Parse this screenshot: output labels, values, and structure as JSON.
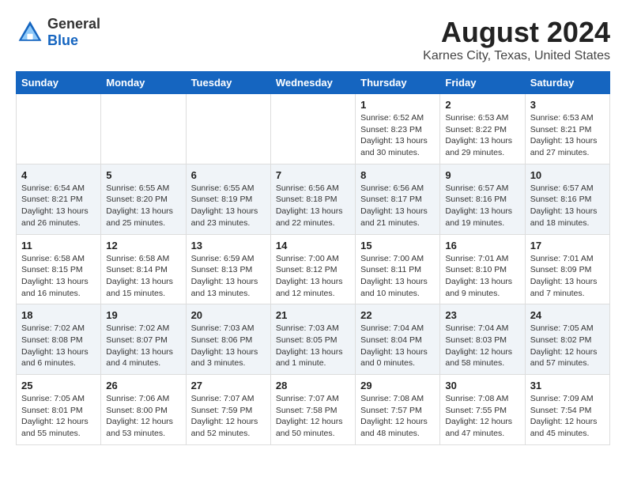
{
  "header": {
    "logo_general": "General",
    "logo_blue": "Blue",
    "month_title": "August 2024",
    "location": "Karnes City, Texas, United States"
  },
  "weekdays": [
    "Sunday",
    "Monday",
    "Tuesday",
    "Wednesday",
    "Thursday",
    "Friday",
    "Saturday"
  ],
  "weeks": [
    [
      {
        "day": "",
        "sunrise": "",
        "sunset": "",
        "daylight": ""
      },
      {
        "day": "",
        "sunrise": "",
        "sunset": "",
        "daylight": ""
      },
      {
        "day": "",
        "sunrise": "",
        "sunset": "",
        "daylight": ""
      },
      {
        "day": "",
        "sunrise": "",
        "sunset": "",
        "daylight": ""
      },
      {
        "day": "1",
        "sunrise": "6:52 AM",
        "sunset": "8:23 PM",
        "daylight": "13 hours and 30 minutes."
      },
      {
        "day": "2",
        "sunrise": "6:53 AM",
        "sunset": "8:22 PM",
        "daylight": "13 hours and 29 minutes."
      },
      {
        "day": "3",
        "sunrise": "6:53 AM",
        "sunset": "8:21 PM",
        "daylight": "13 hours and 27 minutes."
      }
    ],
    [
      {
        "day": "4",
        "sunrise": "6:54 AM",
        "sunset": "8:21 PM",
        "daylight": "13 hours and 26 minutes."
      },
      {
        "day": "5",
        "sunrise": "6:55 AM",
        "sunset": "8:20 PM",
        "daylight": "13 hours and 25 minutes."
      },
      {
        "day": "6",
        "sunrise": "6:55 AM",
        "sunset": "8:19 PM",
        "daylight": "13 hours and 23 minutes."
      },
      {
        "day": "7",
        "sunrise": "6:56 AM",
        "sunset": "8:18 PM",
        "daylight": "13 hours and 22 minutes."
      },
      {
        "day": "8",
        "sunrise": "6:56 AM",
        "sunset": "8:17 PM",
        "daylight": "13 hours and 21 minutes."
      },
      {
        "day": "9",
        "sunrise": "6:57 AM",
        "sunset": "8:16 PM",
        "daylight": "13 hours and 19 minutes."
      },
      {
        "day": "10",
        "sunrise": "6:57 AM",
        "sunset": "8:16 PM",
        "daylight": "13 hours and 18 minutes."
      }
    ],
    [
      {
        "day": "11",
        "sunrise": "6:58 AM",
        "sunset": "8:15 PM",
        "daylight": "13 hours and 16 minutes."
      },
      {
        "day": "12",
        "sunrise": "6:58 AM",
        "sunset": "8:14 PM",
        "daylight": "13 hours and 15 minutes."
      },
      {
        "day": "13",
        "sunrise": "6:59 AM",
        "sunset": "8:13 PM",
        "daylight": "13 hours and 13 minutes."
      },
      {
        "day": "14",
        "sunrise": "7:00 AM",
        "sunset": "8:12 PM",
        "daylight": "13 hours and 12 minutes."
      },
      {
        "day": "15",
        "sunrise": "7:00 AM",
        "sunset": "8:11 PM",
        "daylight": "13 hours and 10 minutes."
      },
      {
        "day": "16",
        "sunrise": "7:01 AM",
        "sunset": "8:10 PM",
        "daylight": "13 hours and 9 minutes."
      },
      {
        "day": "17",
        "sunrise": "7:01 AM",
        "sunset": "8:09 PM",
        "daylight": "13 hours and 7 minutes."
      }
    ],
    [
      {
        "day": "18",
        "sunrise": "7:02 AM",
        "sunset": "8:08 PM",
        "daylight": "13 hours and 6 minutes."
      },
      {
        "day": "19",
        "sunrise": "7:02 AM",
        "sunset": "8:07 PM",
        "daylight": "13 hours and 4 minutes."
      },
      {
        "day": "20",
        "sunrise": "7:03 AM",
        "sunset": "8:06 PM",
        "daylight": "13 hours and 3 minutes."
      },
      {
        "day": "21",
        "sunrise": "7:03 AM",
        "sunset": "8:05 PM",
        "daylight": "13 hours and 1 minute."
      },
      {
        "day": "22",
        "sunrise": "7:04 AM",
        "sunset": "8:04 PM",
        "daylight": "13 hours and 0 minutes."
      },
      {
        "day": "23",
        "sunrise": "7:04 AM",
        "sunset": "8:03 PM",
        "daylight": "12 hours and 58 minutes."
      },
      {
        "day": "24",
        "sunrise": "7:05 AM",
        "sunset": "8:02 PM",
        "daylight": "12 hours and 57 minutes."
      }
    ],
    [
      {
        "day": "25",
        "sunrise": "7:05 AM",
        "sunset": "8:01 PM",
        "daylight": "12 hours and 55 minutes."
      },
      {
        "day": "26",
        "sunrise": "7:06 AM",
        "sunset": "8:00 PM",
        "daylight": "12 hours and 53 minutes."
      },
      {
        "day": "27",
        "sunrise": "7:07 AM",
        "sunset": "7:59 PM",
        "daylight": "12 hours and 52 minutes."
      },
      {
        "day": "28",
        "sunrise": "7:07 AM",
        "sunset": "7:58 PM",
        "daylight": "12 hours and 50 minutes."
      },
      {
        "day": "29",
        "sunrise": "7:08 AM",
        "sunset": "7:57 PM",
        "daylight": "12 hours and 48 minutes."
      },
      {
        "day": "30",
        "sunrise": "7:08 AM",
        "sunset": "7:55 PM",
        "daylight": "12 hours and 47 minutes."
      },
      {
        "day": "31",
        "sunrise": "7:09 AM",
        "sunset": "7:54 PM",
        "daylight": "12 hours and 45 minutes."
      }
    ]
  ]
}
